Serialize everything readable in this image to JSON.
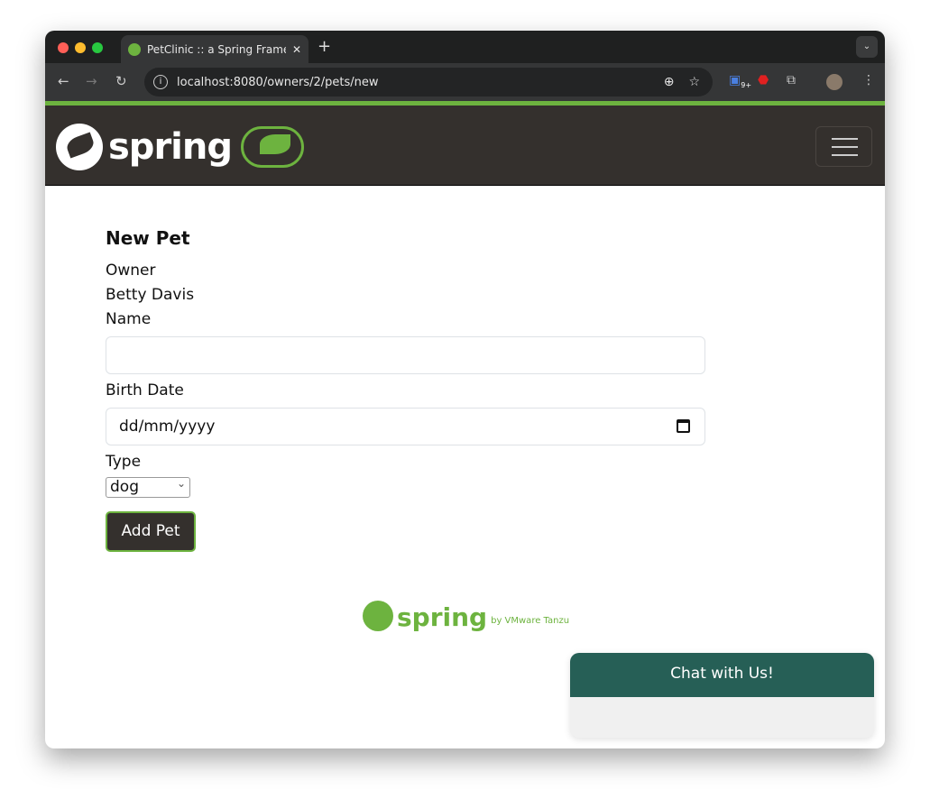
{
  "browser": {
    "tab_title": "PetClinic :: a Spring Framework demonstration",
    "url": "localhost:8080/owners/2/pets/new",
    "extension_badge": "9+"
  },
  "form": {
    "title": "New Pet",
    "owner_label": "Owner",
    "owner_value": "Betty Davis",
    "name_label": "Name",
    "name_value": "",
    "birth_label": "Birth Date",
    "birth_placeholder": "dd/mm/yyyy",
    "type_label": "Type",
    "type_value": "dog",
    "submit": "Add Pet"
  },
  "navbar": {
    "logo_text": "spring"
  },
  "footer": {
    "logo_text": "spring",
    "by": "by VMware Tanzu"
  },
  "chat": {
    "title": "Chat with Us!"
  },
  "colors": {
    "brand_green": "#6db33f",
    "nav_bg": "#34302d",
    "chat_header": "#265f56"
  }
}
